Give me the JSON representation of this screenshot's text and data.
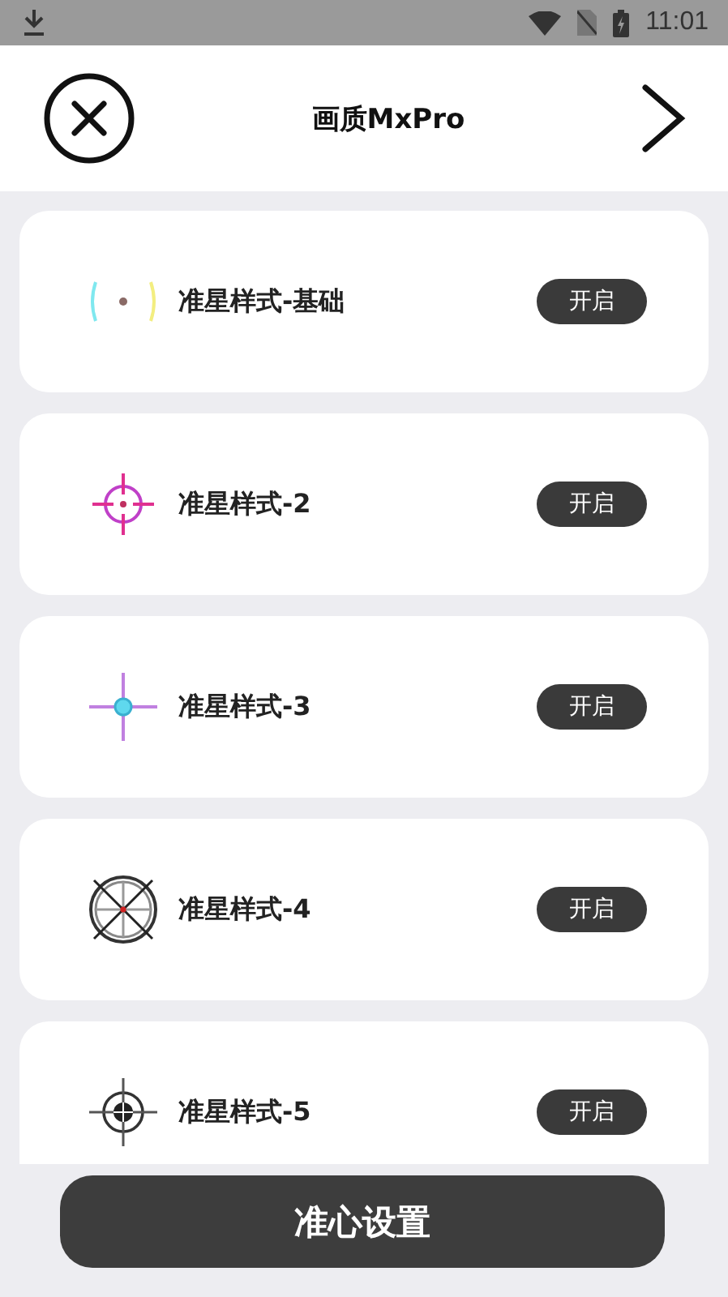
{
  "status_bar": {
    "time": "11:01"
  },
  "header": {
    "title": "画质MxPro"
  },
  "crosshairs": [
    {
      "kind": "bracket",
      "label": "准星样式-基础",
      "action": "开启"
    },
    {
      "kind": "reticle",
      "label": "准星样式-2",
      "action": "开启"
    },
    {
      "kind": "cross",
      "label": "准星样式-3",
      "action": "开启"
    },
    {
      "kind": "wheel",
      "label": "准星样式-4",
      "action": "开启"
    },
    {
      "kind": "scope",
      "label": "准星样式-5",
      "action": "开启"
    }
  ],
  "bottom_button": {
    "label": "准心设置"
  }
}
